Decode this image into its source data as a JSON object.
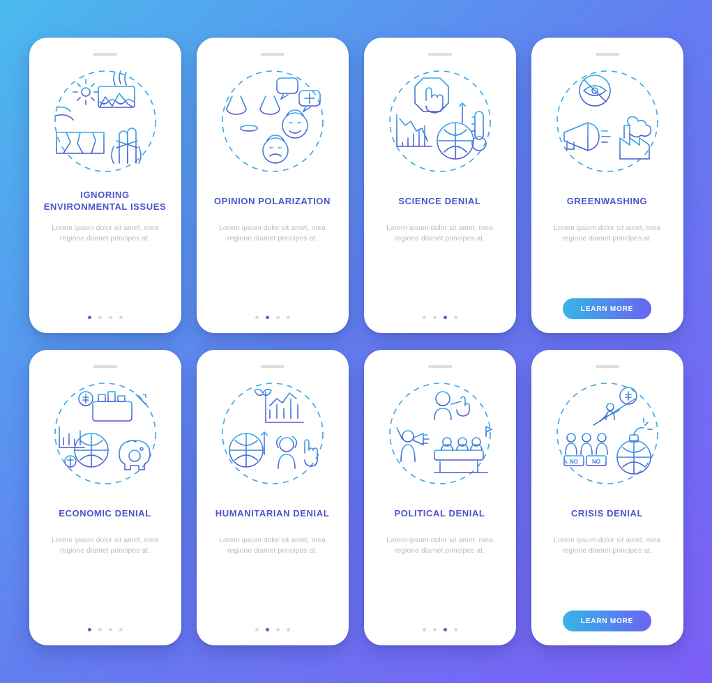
{
  "colors": {
    "title": "#4c54c9",
    "desc": "#b7bcc8",
    "stroke_top": "#34a9e8",
    "stroke_bottom": "#5457cf",
    "btn_grad_from": "#35b6e8",
    "btn_grad_to": "#6b63f2"
  },
  "common_desc": "Lorem ipsum dolor sit amet, mea regione diamet principes at.",
  "button_label": "LEARN MORE",
  "rows": [
    {
      "cards": [
        {
          "id": "env",
          "title": "IGNORING ENVIRONMENTAL ISSUES",
          "dots_total": 4,
          "dots_active": 0,
          "has_button": false
        },
        {
          "id": "opin",
          "title": "OPINION POLARIZATION",
          "dots_total": 4,
          "dots_active": 1,
          "has_button": false
        },
        {
          "id": "sci",
          "title": "SCIENCE DENIAL",
          "dots_total": 4,
          "dots_active": 2,
          "has_button": false
        },
        {
          "id": "green",
          "title": "GREENWASHING",
          "dots_total": 4,
          "dots_active": 3,
          "has_button": true
        }
      ]
    },
    {
      "cards": [
        {
          "id": "econ",
          "title": "ECONOMIC DENIAL",
          "dots_total": 4,
          "dots_active": 0,
          "has_button": false
        },
        {
          "id": "hum",
          "title": "HUMANITARIAN DENIAL",
          "dots_total": 4,
          "dots_active": 1,
          "has_button": false
        },
        {
          "id": "pol",
          "title": "POLITICAL DENIAL",
          "dots_total": 4,
          "dots_active": 2,
          "has_button": false
        },
        {
          "id": "crisis",
          "title": "CRISIS DENIAL",
          "dots_total": 4,
          "dots_active": 3,
          "has_button": true
        }
      ]
    }
  ]
}
